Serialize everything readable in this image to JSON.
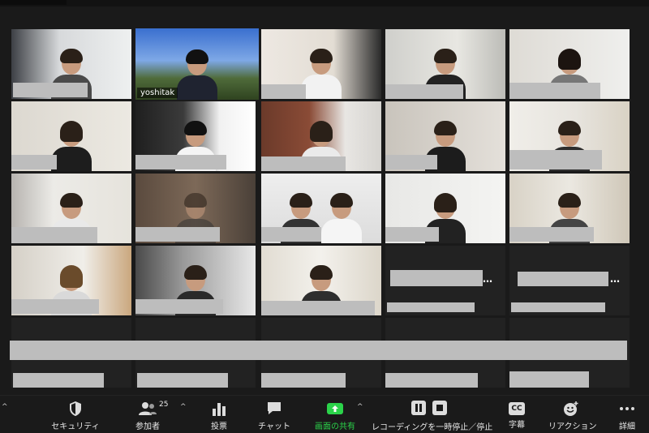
{
  "meeting": {
    "active_speaker_name": "yoshitak"
  },
  "toolbar": {
    "security": "セキュリティ",
    "participants": "参加者",
    "participants_count": "25",
    "polls": "投票",
    "chat": "チャット",
    "share_screen": "画面の共有",
    "recording": "レコーディングを一時停止／停止",
    "captions": "字幕",
    "captions_icon_text": "CC",
    "reactions": "リアクション",
    "more": "詳細"
  },
  "colors": {
    "active_border": "#b6db5a",
    "share_green": "#2bd34a",
    "background": "#1a1a1a"
  },
  "icons": [
    "shield-icon",
    "participants-icon",
    "polls-icon",
    "chat-icon",
    "share-screen-icon",
    "pause-icon",
    "stop-icon",
    "cc-icon",
    "reaction-icon",
    "more-icon"
  ]
}
